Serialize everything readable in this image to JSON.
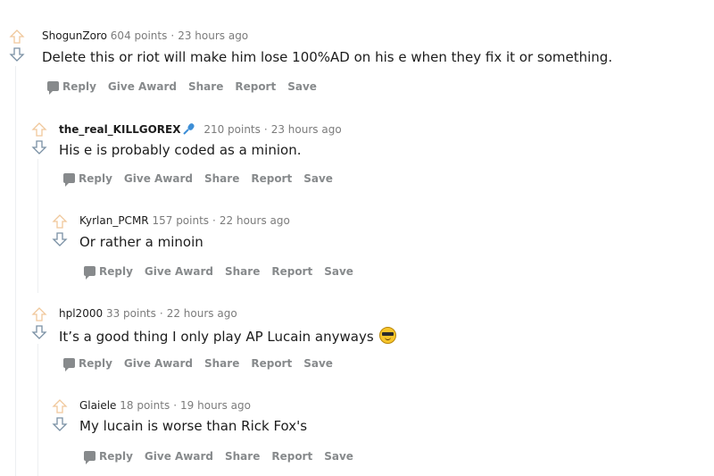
{
  "comments": [
    {
      "author": "ShogunZoro",
      "points": "604 points",
      "time": "23 hours ago",
      "body": "Delete this or riot will make him lose 100%AD on his e when they fix it or something."
    },
    {
      "author": "the_real_KILLGOREX",
      "points": "210 points",
      "time": "23 hours ago",
      "body": "His e is probably coded as a minion."
    },
    {
      "author": "Kyrlan_PCMR",
      "points": "157 points",
      "time": "22 hours ago",
      "body": "Or rather a minoin"
    },
    {
      "author": "hpl2000",
      "points": "33 points",
      "time": "22 hours ago",
      "body": "It’s a good thing I only play AP Lucain anyways"
    },
    {
      "author": "Glaiele",
      "points": "18 points",
      "time": "19 hours ago",
      "body": "My lucain is worse than Rick Fox's"
    }
  ],
  "actions": {
    "reply": "Reply",
    "give_award": "Give Award",
    "share": "Share",
    "report": "Report",
    "save": "Save"
  },
  "separator": "·",
  "icons": {
    "upvote": "arrow-up-icon",
    "downvote": "arrow-down-icon",
    "flair": "microphone-icon",
    "emoji": "sunglasses-emoji-icon",
    "reply": "comment-icon"
  },
  "colors": {
    "upvote": "#f0c89c",
    "downvote": "#7a90a4",
    "meta": "#7c7c7c",
    "action": "#878a8c"
  }
}
